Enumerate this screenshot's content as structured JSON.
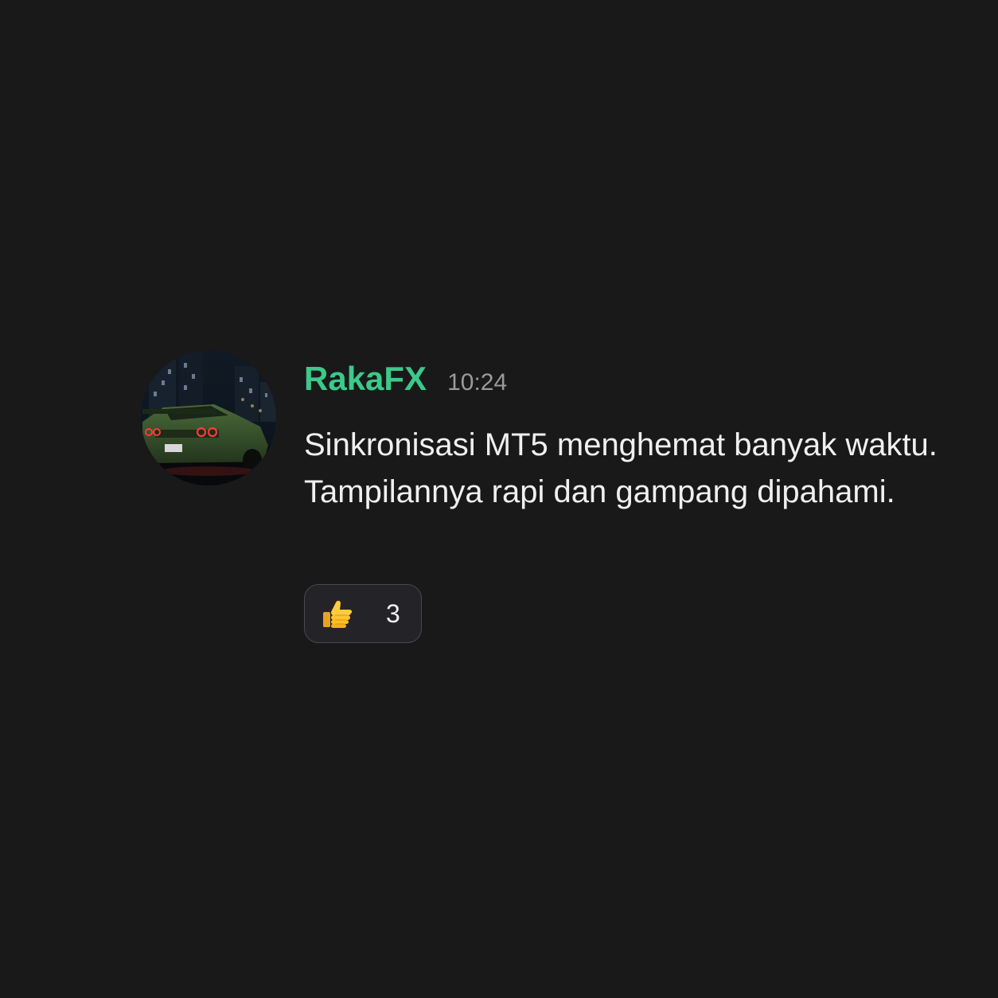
{
  "message": {
    "author": "RakaFX",
    "time": "10:24",
    "text": "Sinkronisasi MT5 menghemat banyak waktu. Tampilannya rapi dan gampang dipahami.",
    "avatar_icon": "green-sports-car-night-city",
    "reactions": [
      {
        "emoji": "thumbs-up-icon",
        "count": "3"
      }
    ]
  },
  "colors": {
    "background": "#19191a",
    "username": "#3cc98a",
    "timestamp": "#9a9a9c",
    "text": "#f0f0f0",
    "reaction_bg": "#242428",
    "reaction_border": "#4a4a4e"
  }
}
